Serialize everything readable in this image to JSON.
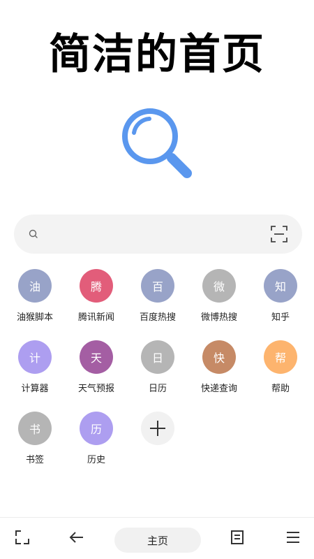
{
  "headline": "简洁的首页",
  "search": {
    "placeholder": "",
    "value": ""
  },
  "shortcuts": [
    {
      "glyph": "油",
      "label": "油猴脚本",
      "color": "#98a3c8"
    },
    {
      "glyph": "腾",
      "label": "腾讯新闻",
      "color": "#e25d7a"
    },
    {
      "glyph": "百",
      "label": "百度热搜",
      "color": "#98a3c8"
    },
    {
      "glyph": "微",
      "label": "微博热搜",
      "color": "#b5b5b5"
    },
    {
      "glyph": "知",
      "label": "知乎",
      "color": "#98a3c8"
    },
    {
      "glyph": "计",
      "label": "计算器",
      "color": "#ad9ef0"
    },
    {
      "glyph": "天",
      "label": "天气预报",
      "color": "#a45ea3"
    },
    {
      "glyph": "日",
      "label": "日历",
      "color": "#b5b5b5"
    },
    {
      "glyph": "快",
      "label": "快递查询",
      "color": "#c68a66"
    },
    {
      "glyph": "帮",
      "label": "帮助",
      "color": "#fdb46e"
    },
    {
      "glyph": "书",
      "label": "书签",
      "color": "#b5b5b5"
    },
    {
      "glyph": "历",
      "label": "历史",
      "color": "#ad9ef0"
    }
  ],
  "colors": {
    "logo_blue": "#5a97ee",
    "search_bg": "#f3f3f3",
    "icon_gray": "#444444"
  },
  "icons": {
    "logo": "magnifier-logo-icon",
    "search": "search-icon",
    "scan": "scan-icon",
    "add": "plus-icon",
    "tabs": "tabs-icon",
    "back": "back-arrow-icon",
    "reader": "reader-icon",
    "menu": "menu-icon"
  },
  "bottom_bar": {
    "home_label": "主页"
  }
}
